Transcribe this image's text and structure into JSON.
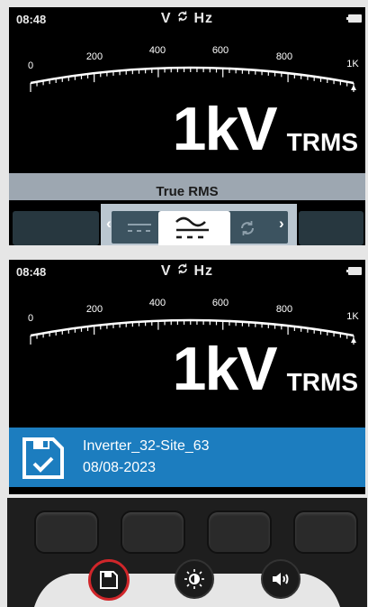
{
  "screen_top": {
    "time": "08:48",
    "mode": {
      "left": "V",
      "right": "Hz",
      "cycle_icon": "ac-dc-cycle-icon"
    },
    "scale_labels": [
      "0",
      "200",
      "400",
      "600",
      "800",
      "1K"
    ],
    "reading": {
      "value": "1kV",
      "unit": "TRMS"
    },
    "rms_title": "True RMS",
    "selector": {
      "left_arrow": "‹",
      "right_arrow": "›",
      "options_icons": [
        "dc-icon",
        "ac-dc-icon",
        "cycle-icon"
      ]
    }
  },
  "screen_bottom": {
    "time": "08:48",
    "mode": {
      "left": "V",
      "right": "Hz",
      "cycle_icon": "ac-dc-cycle-icon"
    },
    "scale_labels": [
      "0",
      "200",
      "400",
      "600",
      "800",
      "1K"
    ],
    "reading": {
      "value": "1kV",
      "unit": "TRMS"
    },
    "saved_file": {
      "name": "Inverter_32-Site_63",
      "date": "08/08-2023",
      "icon": "save-check-icon"
    }
  },
  "buttons": {
    "round": [
      "save-icon",
      "brightness-icon",
      "speaker-icon"
    ],
    "accent_color": "#d0262a"
  },
  "colors": {
    "info_bar": "#1c7dbf",
    "rms_bar": "#9da7b1"
  }
}
